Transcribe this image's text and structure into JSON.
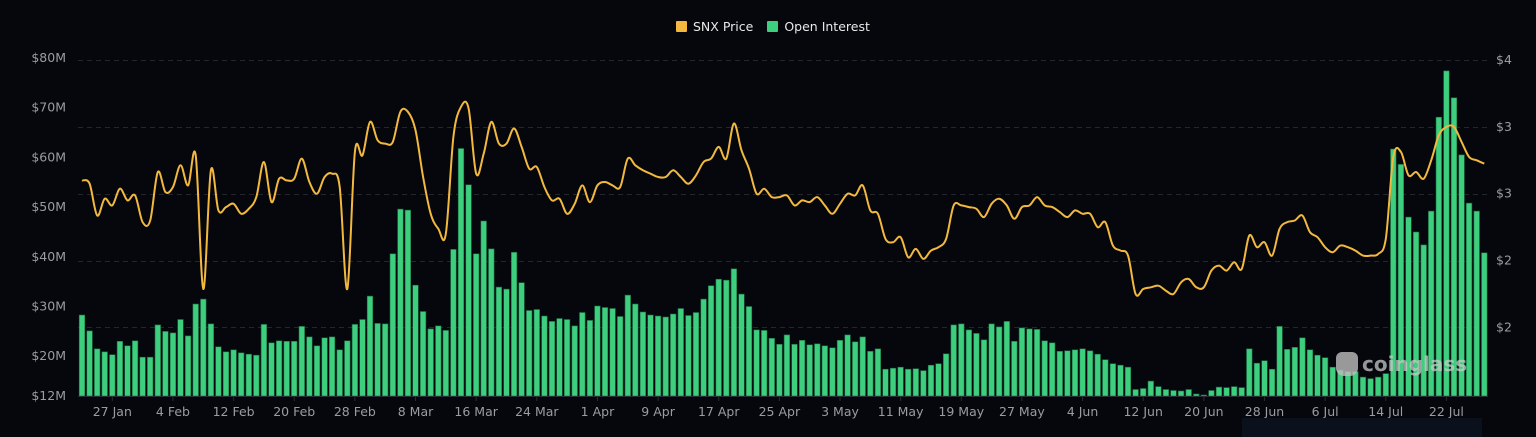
{
  "legend": {
    "items": [
      {
        "label": "SNX Price",
        "color": "#f3b93f"
      },
      {
        "label": "Open Interest",
        "color": "#3ecf7e"
      }
    ]
  },
  "watermark": "coinglass",
  "chart_data": {
    "type": "bar+line",
    "grid": true,
    "legend_position": "top-center",
    "x_tick_labels": [
      "27 Jan",
      "4 Feb",
      "12 Feb",
      "20 Feb",
      "28 Feb",
      "8 Mar",
      "16 Mar",
      "24 Mar",
      "1 Apr",
      "9 Apr",
      "17 Apr",
      "25 Apr",
      "3 May",
      "11 May",
      "19 May",
      "27 May",
      "4 Jun",
      "12 Jun",
      "20 Jun",
      "28 Jun",
      "6 Jul",
      "14 Jul",
      "22 Jul"
    ],
    "y_left": {
      "ticks": [
        80,
        70,
        60,
        50,
        40,
        30,
        20,
        12
      ],
      "tick_labels": [
        "$80M",
        "$70M",
        "$60M",
        "$50M",
        "$40M",
        "$30M",
        "$20M",
        "$12M"
      ],
      "ylim": [
        12,
        80
      ]
    },
    "y_right": {
      "ticks": [
        3.6,
        3.2,
        2.8,
        2.4,
        2.0
      ],
      "tick_labels": [
        "$4",
        "$3",
        "$3",
        "$2",
        "$2"
      ],
      "ylim": [
        1.59,
        3.6
      ]
    },
    "categories": [
      "23 Jan",
      "24 Jan",
      "25 Jan",
      "26 Jan",
      "27 Jan",
      "28 Jan",
      "29 Jan",
      "30 Jan",
      "31 Jan",
      "1 Feb",
      "2 Feb",
      "3 Feb",
      "4 Feb",
      "5 Feb",
      "6 Feb",
      "7 Feb",
      "8 Feb",
      "9 Feb",
      "10 Feb",
      "11 Feb",
      "12 Feb",
      "13 Feb",
      "14 Feb",
      "15 Feb",
      "16 Feb",
      "17 Feb",
      "18 Feb",
      "19 Feb",
      "20 Feb",
      "21 Feb",
      "22 Feb",
      "23 Feb",
      "24 Feb",
      "25 Feb",
      "26 Feb",
      "27 Feb",
      "28 Feb",
      "1 Mar",
      "2 Mar",
      "3 Mar",
      "4 Mar",
      "5 Mar",
      "6 Mar",
      "7 Mar",
      "8 Mar",
      "9 Mar",
      "10 Mar",
      "11 Mar",
      "12 Mar",
      "13 Mar",
      "14 Mar",
      "15 Mar",
      "16 Mar",
      "17 Mar",
      "18 Mar",
      "19 Mar",
      "20 Mar",
      "21 Mar",
      "22 Mar",
      "23 Mar",
      "24 Mar",
      "25 Mar",
      "26 Mar",
      "27 Mar",
      "28 Mar",
      "29 Mar",
      "30 Mar",
      "31 Mar",
      "1 Apr",
      "2 Apr",
      "3 Apr",
      "4 Apr",
      "5 Apr",
      "6 Apr",
      "7 Apr",
      "8 Apr",
      "9 Apr",
      "10 Apr",
      "11 Apr",
      "12 Apr",
      "13 Apr",
      "14 Apr",
      "15 Apr",
      "16 Apr",
      "17 Apr",
      "18 Apr",
      "19 Apr",
      "20 Apr",
      "21 Apr",
      "22 Apr",
      "23 Apr",
      "24 Apr",
      "25 Apr",
      "26 Apr",
      "27 Apr",
      "28 Apr",
      "29 Apr",
      "30 Apr",
      "1 May",
      "2 May",
      "3 May",
      "4 May",
      "5 May",
      "6 May",
      "7 May",
      "8 May",
      "9 May",
      "10 May",
      "11 May",
      "12 May",
      "13 May",
      "14 May",
      "15 May",
      "16 May",
      "17 May",
      "18 May",
      "19 May",
      "20 May",
      "21 May",
      "22 May",
      "23 May",
      "24 May",
      "25 May",
      "26 May",
      "27 May",
      "28 May",
      "29 May",
      "30 May",
      "31 May",
      "1 Jun",
      "2 Jun",
      "3 Jun",
      "4 Jun",
      "5 Jun",
      "6 Jun",
      "7 Jun",
      "8 Jun",
      "9 Jun",
      "10 Jun",
      "11 Jun",
      "12 Jun",
      "13 Jun",
      "14 Jun",
      "15 Jun",
      "16 Jun",
      "17 Jun",
      "18 Jun",
      "19 Jun",
      "20 Jun",
      "21 Jun",
      "22 Jun",
      "23 Jun",
      "24 Jun",
      "25 Jun",
      "26 Jun",
      "27 Jun",
      "28 Jun",
      "29 Jun",
      "30 Jun",
      "1 Jul",
      "2 Jul",
      "3 Jul",
      "4 Jul",
      "5 Jul",
      "6 Jul",
      "7 Jul",
      "8 Jul",
      "9 Jul",
      "10 Jul",
      "11 Jul",
      "12 Jul",
      "13 Jul",
      "14 Jul",
      "15 Jul",
      "16 Jul",
      "17 Jul",
      "18 Jul",
      "19 Jul",
      "20 Jul",
      "21 Jul",
      "22 Jul",
      "23 Jul",
      "24 Jul",
      "25 Jul",
      "26 Jul",
      "27 Jul"
    ],
    "series": [
      {
        "name": "Open Interest",
        "type": "bar",
        "axis": "left",
        "color": "#3ecf7e",
        "values": [
          28.3,
          25.1,
          21.5,
          20.9,
          20.3,
          23.0,
          22.1,
          23.1,
          19.8,
          19.8,
          26.3,
          25.0,
          24.7,
          27.4,
          24.1,
          30.5,
          31.5,
          26.5,
          21.9,
          20.9,
          21.3,
          20.7,
          20.4,
          20.2,
          26.4,
          22.7,
          23.1,
          23.0,
          23.0,
          26.0,
          23.9,
          22.1,
          23.7,
          23.9,
          21.3,
          23.1,
          26.4,
          27.4,
          32.1,
          26.6,
          26.5,
          40.6,
          49.6,
          49.4,
          34.3,
          29.0,
          25.5,
          26.1,
          25.2,
          41.5,
          61.8,
          54.5,
          40.6,
          47.2,
          41.6,
          33.9,
          33.5,
          40.9,
          34.8,
          29.2,
          29.4,
          28.1,
          27.0,
          27.6,
          27.4,
          26.1,
          28.8,
          27.2,
          30.1,
          29.8,
          29.6,
          28.0,
          32.3,
          30.5,
          28.9,
          28.3,
          28.1,
          27.9,
          28.5,
          29.6,
          28.2,
          28.8,
          31.5,
          34.2,
          35.5,
          35.3,
          37.6,
          32.5,
          30.0,
          25.3,
          25.2,
          23.6,
          22.4,
          24.3,
          22.4,
          23.2,
          22.3,
          22.5,
          22.1,
          21.7,
          23.2,
          24.3,
          22.9,
          23.9,
          21.0,
          21.5,
          17.4,
          17.6,
          17.8,
          17.4,
          17.5,
          17.1,
          18.2,
          18.5,
          20.5,
          26.3,
          26.5,
          25.3,
          24.6,
          23.3,
          26.5,
          25.9,
          27.0,
          23.0,
          25.7,
          25.5,
          25.4,
          23.1,
          22.7,
          21.0,
          21.1,
          21.3,
          21.5,
          21.1,
          20.4,
          19.3,
          18.5,
          18.2,
          17.8,
          13.3,
          13.5,
          15.0,
          13.9,
          13.3,
          13.1,
          13.0,
          13.3,
          12.4,
          12.2,
          13.1,
          13.8,
          13.7,
          13.9,
          13.7,
          21.5,
          18.6,
          19.1,
          17.4,
          26.0,
          21.4,
          21.8,
          23.7,
          21.3,
          20.2,
          19.7,
          17.8,
          17.2,
          16.9,
          16.9,
          15.8,
          15.5,
          15.8,
          16.5,
          61.7,
          58.6,
          48.0,
          45.0,
          42.4,
          49.2,
          68.1,
          77.4,
          72.0,
          60.5,
          50.8,
          49.2,
          40.8
        ]
      },
      {
        "name": "SNX Price",
        "type": "line",
        "axis": "right",
        "color": "#f3b93f",
        "values": [
          2.88,
          2.86,
          2.67,
          2.77,
          2.73,
          2.83,
          2.76,
          2.79,
          2.63,
          2.64,
          2.93,
          2.81,
          2.84,
          2.97,
          2.85,
          3.03,
          2.23,
          2.94,
          2.7,
          2.72,
          2.74,
          2.68,
          2.71,
          2.78,
          2.99,
          2.75,
          2.89,
          2.88,
          2.89,
          3.01,
          2.87,
          2.8,
          2.9,
          2.92,
          2.84,
          2.23,
          3.05,
          3.03,
          3.23,
          3.12,
          3.1,
          3.11,
          3.29,
          3.29,
          3.18,
          2.9,
          2.68,
          2.59,
          2.56,
          3.14,
          3.32,
          3.31,
          2.92,
          3.04,
          3.23,
          3.1,
          3.1,
          3.19,
          3.08,
          2.95,
          2.96,
          2.84,
          2.76,
          2.77,
          2.68,
          2.74,
          2.85,
          2.75,
          2.85,
          2.87,
          2.85,
          2.84,
          3.01,
          2.97,
          2.94,
          2.92,
          2.9,
          2.9,
          2.94,
          2.9,
          2.86,
          2.91,
          2.99,
          3.01,
          3.08,
          3.01,
          3.22,
          3.06,
          2.95,
          2.8,
          2.83,
          2.78,
          2.78,
          2.79,
          2.73,
          2.76,
          2.75,
          2.78,
          2.73,
          2.68,
          2.74,
          2.8,
          2.79,
          2.85,
          2.7,
          2.68,
          2.53,
          2.51,
          2.54,
          2.42,
          2.47,
          2.41,
          2.46,
          2.48,
          2.53,
          2.73,
          2.73,
          2.72,
          2.71,
          2.66,
          2.74,
          2.77,
          2.73,
          2.65,
          2.72,
          2.73,
          2.78,
          2.73,
          2.72,
          2.69,
          2.66,
          2.7,
          2.68,
          2.68,
          2.6,
          2.63,
          2.49,
          2.46,
          2.43,
          2.2,
          2.23,
          2.24,
          2.25,
          2.22,
          2.2,
          2.27,
          2.29,
          2.24,
          2.24,
          2.34,
          2.37,
          2.34,
          2.39,
          2.35,
          2.55,
          2.48,
          2.51,
          2.43,
          2.59,
          2.63,
          2.64,
          2.67,
          2.57,
          2.54,
          2.48,
          2.45,
          2.49,
          2.48,
          2.46,
          2.43,
          2.43,
          2.44,
          2.53,
          3.02,
          3.05,
          2.91,
          2.93,
          2.89,
          3.0,
          3.15,
          3.2,
          3.2,
          3.11,
          3.02,
          3.0,
          2.98
        ]
      }
    ]
  }
}
